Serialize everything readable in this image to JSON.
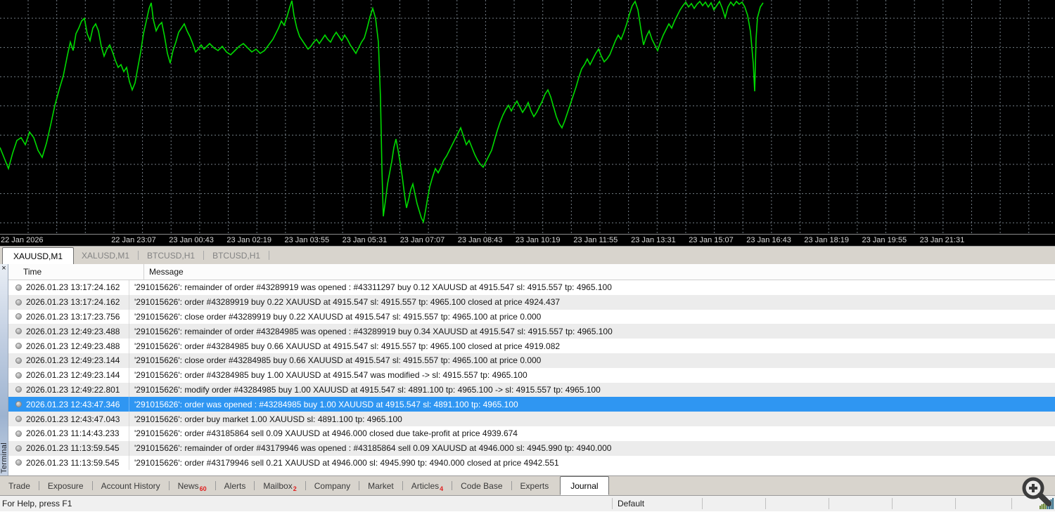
{
  "chart": {
    "background": "#000000",
    "grid_color": "#737d85",
    "line_color": "#00da00",
    "axis_line_color": "#9a9a9a",
    "axis_labels": [
      "22 Jan 2026",
      "22 Jan 23:07",
      "23 Jan 00:43",
      "23 Jan 02:19",
      "23 Jan 03:55",
      "23 Jan 05:31",
      "23 Jan 07:07",
      "23 Jan 08:43",
      "23 Jan 10:19",
      "23 Jan 11:55",
      "23 Jan 13:31",
      "23 Jan 15:07",
      "23 Jan 16:43",
      "23 Jan 18:19",
      "23 Jan 19:55",
      "23 Jan 21:31"
    ],
    "line_points": [
      [
        0,
        210
      ],
      [
        6,
        225
      ],
      [
        12,
        240
      ],
      [
        18,
        218
      ],
      [
        24,
        200
      ],
      [
        30,
        196
      ],
      [
        36,
        206
      ],
      [
        42,
        188
      ],
      [
        48,
        196
      ],
      [
        54,
        214
      ],
      [
        60,
        224
      ],
      [
        66,
        204
      ],
      [
        72,
        178
      ],
      [
        78,
        150
      ],
      [
        84,
        128
      ],
      [
        90,
        108
      ],
      [
        96,
        78
      ],
      [
        100,
        60
      ],
      [
        104,
        72
      ],
      [
        108,
        48
      ],
      [
        112,
        40
      ],
      [
        116,
        30
      ],
      [
        120,
        26
      ],
      [
        124,
        48
      ],
      [
        128,
        58
      ],
      [
        132,
        40
      ],
      [
        136,
        34
      ],
      [
        140,
        44
      ],
      [
        144,
        66
      ],
      [
        148,
        80
      ],
      [
        152,
        70
      ],
      [
        156,
        64
      ],
      [
        160,
        74
      ],
      [
        164,
        86
      ],
      [
        168,
        96
      ],
      [
        172,
        92
      ],
      [
        176,
        102
      ],
      [
        180,
        96
      ],
      [
        184,
        116
      ],
      [
        188,
        128
      ],
      [
        192,
        118
      ],
      [
        196,
        96
      ],
      [
        200,
        74
      ],
      [
        204,
        48
      ],
      [
        208,
        30
      ],
      [
        212,
        12
      ],
      [
        215,
        4
      ],
      [
        218,
        28
      ],
      [
        222,
        44
      ],
      [
        226,
        36
      ],
      [
        230,
        32
      ],
      [
        234,
        52
      ],
      [
        238,
        76
      ],
      [
        242,
        90
      ],
      [
        246,
        72
      ],
      [
        250,
        60
      ],
      [
        254,
        46
      ],
      [
        258,
        40
      ],
      [
        262,
        34
      ],
      [
        266,
        44
      ],
      [
        270,
        52
      ],
      [
        274,
        62
      ],
      [
        278,
        74
      ],
      [
        282,
        70
      ],
      [
        286,
        64
      ],
      [
        290,
        70
      ],
      [
        294,
        66
      ],
      [
        298,
        62
      ],
      [
        304,
        68
      ],
      [
        310,
        72
      ],
      [
        316,
        66
      ],
      [
        322,
        74
      ],
      [
        328,
        78
      ],
      [
        334,
        72
      ],
      [
        340,
        66
      ],
      [
        346,
        62
      ],
      [
        352,
        68
      ],
      [
        358,
        74
      ],
      [
        364,
        70
      ],
      [
        370,
        76
      ],
      [
        376,
        72
      ],
      [
        382,
        64
      ],
      [
        388,
        56
      ],
      [
        392,
        48
      ],
      [
        396,
        40
      ],
      [
        400,
        30
      ],
      [
        404,
        36
      ],
      [
        408,
        24
      ],
      [
        412,
        10
      ],
      [
        415,
        1
      ],
      [
        418,
        22
      ],
      [
        422,
        40
      ],
      [
        426,
        52
      ],
      [
        430,
        58
      ],
      [
        434,
        64
      ],
      [
        438,
        70
      ],
      [
        442,
        66
      ],
      [
        446,
        60
      ],
      [
        450,
        56
      ],
      [
        454,
        62
      ],
      [
        458,
        56
      ],
      [
        462,
        50
      ],
      [
        466,
        56
      ],
      [
        470,
        60
      ],
      [
        474,
        52
      ],
      [
        478,
        46
      ],
      [
        482,
        52
      ],
      [
        486,
        58
      ],
      [
        490,
        50
      ],
      [
        494,
        56
      ],
      [
        498,
        64
      ],
      [
        502,
        70
      ],
      [
        506,
        76
      ],
      [
        510,
        68
      ],
      [
        514,
        60
      ],
      [
        518,
        54
      ],
      [
        522,
        40
      ],
      [
        526,
        24
      ],
      [
        530,
        12
      ],
      [
        534,
        26
      ],
      [
        538,
        60
      ],
      [
        541,
        140
      ],
      [
        543,
        240
      ],
      [
        545,
        308
      ],
      [
        548,
        286
      ],
      [
        551,
        262
      ],
      [
        554,
        246
      ],
      [
        557,
        230
      ],
      [
        560,
        210
      ],
      [
        563,
        198
      ],
      [
        566,
        214
      ],
      [
        569,
        232
      ],
      [
        572,
        252
      ],
      [
        575,
        276
      ],
      [
        578,
        296
      ],
      [
        581,
        284
      ],
      [
        584,
        270
      ],
      [
        587,
        262
      ],
      [
        590,
        276
      ],
      [
        593,
        290
      ],
      [
        596,
        300
      ],
      [
        599,
        310
      ],
      [
        602,
        316
      ],
      [
        605,
        300
      ],
      [
        608,
        282
      ],
      [
        611,
        266
      ],
      [
        615,
        252
      ],
      [
        619,
        240
      ],
      [
        623,
        246
      ],
      [
        627,
        238
      ],
      [
        631,
        228
      ],
      [
        635,
        222
      ],
      [
        639,
        214
      ],
      [
        643,
        206
      ],
      [
        647,
        198
      ],
      [
        651,
        190
      ],
      [
        655,
        182
      ],
      [
        659,
        194
      ],
      [
        663,
        206
      ],
      [
        667,
        200
      ],
      [
        671,
        210
      ],
      [
        675,
        220
      ],
      [
        679,
        228
      ],
      [
        683,
        234
      ],
      [
        687,
        238
      ],
      [
        691,
        230
      ],
      [
        695,
        222
      ],
      [
        699,
        214
      ],
      [
        703,
        200
      ],
      [
        707,
        186
      ],
      [
        711,
        174
      ],
      [
        715,
        164
      ],
      [
        719,
        156
      ],
      [
        723,
        150
      ],
      [
        727,
        158
      ],
      [
        731,
        150
      ],
      [
        735,
        144
      ],
      [
        739,
        152
      ],
      [
        743,
        160
      ],
      [
        747,
        154
      ],
      [
        751,
        146
      ],
      [
        755,
        158
      ],
      [
        759,
        166
      ],
      [
        763,
        160
      ],
      [
        767,
        152
      ],
      [
        771,
        144
      ],
      [
        775,
        134
      ],
      [
        779,
        128
      ],
      [
        783,
        138
      ],
      [
        787,
        152
      ],
      [
        791,
        166
      ],
      [
        795,
        176
      ],
      [
        799,
        182
      ],
      [
        803,
        172
      ],
      [
        807,
        160
      ],
      [
        811,
        148
      ],
      [
        815,
        136
      ],
      [
        819,
        124
      ],
      [
        823,
        110
      ],
      [
        827,
        98
      ],
      [
        831,
        92
      ],
      [
        835,
        84
      ],
      [
        839,
        92
      ],
      [
        843,
        84
      ],
      [
        847,
        76
      ],
      [
        851,
        70
      ],
      [
        855,
        80
      ],
      [
        859,
        88
      ],
      [
        863,
        84
      ],
      [
        867,
        78
      ],
      [
        871,
        68
      ],
      [
        875,
        58
      ],
      [
        879,
        50
      ],
      [
        883,
        56
      ],
      [
        887,
        46
      ],
      [
        891,
        34
      ],
      [
        895,
        20
      ],
      [
        899,
        8
      ],
      [
        903,
        2
      ],
      [
        907,
        14
      ],
      [
        911,
        40
      ],
      [
        915,
        64
      ],
      [
        919,
        52
      ],
      [
        923,
        44
      ],
      [
        927,
        56
      ],
      [
        931,
        64
      ],
      [
        935,
        72
      ],
      [
        939,
        60
      ],
      [
        943,
        50
      ],
      [
        947,
        42
      ],
      [
        951,
        34
      ],
      [
        955,
        40
      ],
      [
        959,
        30
      ],
      [
        963,
        22
      ],
      [
        967,
        14
      ],
      [
        971,
        8
      ],
      [
        975,
        3
      ],
      [
        979,
        10
      ],
      [
        983,
        5
      ],
      [
        987,
        12
      ],
      [
        991,
        6
      ],
      [
        995,
        2
      ],
      [
        999,
        8
      ],
      [
        1003,
        3
      ],
      [
        1007,
        10
      ],
      [
        1011,
        4
      ],
      [
        1015,
        14
      ],
      [
        1019,
        8
      ],
      [
        1023,
        2
      ],
      [
        1027,
        12
      ],
      [
        1031,
        25
      ],
      [
        1035,
        10
      ],
      [
        1039,
        3
      ],
      [
        1043,
        8
      ],
      [
        1047,
        2
      ],
      [
        1051,
        6
      ],
      [
        1055,
        3
      ],
      [
        1059,
        10
      ],
      [
        1063,
        22
      ],
      [
        1067,
        45
      ],
      [
        1071,
        90
      ],
      [
        1073,
        130
      ],
      [
        1075,
        55
      ],
      [
        1077,
        25
      ],
      [
        1081,
        10
      ],
      [
        1085,
        4
      ]
    ]
  },
  "chart_tabs": [
    {
      "label": "XAUUSD,M1",
      "active": true
    },
    {
      "label": "XALUSD,M1",
      "active": false
    },
    {
      "label": "BTCUSD,H1",
      "active": false
    },
    {
      "label": "BTCUSD,H1",
      "active": false
    }
  ],
  "terminal": {
    "close_label": "×",
    "panel_label": "Terminal",
    "columns": [
      "Time",
      "Message"
    ],
    "selected_row_color": "#2f96f2",
    "rows": [
      {
        "time": "2026.01.23 13:17:24.162",
        "message": "'291015626': remainder of order #43289919 was opened : #43311297 buy 0.12 XAUUSD at 4915.547 sl: 4915.557 tp: 4965.100",
        "selected": false
      },
      {
        "time": "2026.01.23 13:17:24.162",
        "message": "'291015626': order #43289919 buy 0.22 XAUUSD at 4915.547 sl: 4915.557 tp: 4965.100 closed at price 4924.437",
        "selected": false
      },
      {
        "time": "2026.01.23 13:17:23.756",
        "message": "'291015626': close order #43289919 buy 0.22 XAUUSD at 4915.547 sl: 4915.557 tp: 4965.100 at price 0.000",
        "selected": false
      },
      {
        "time": "2026.01.23 12:49:23.488",
        "message": "'291015626': remainder of order #43284985 was opened : #43289919 buy 0.34 XAUUSD at 4915.547 sl: 4915.557 tp: 4965.100",
        "selected": false
      },
      {
        "time": "2026.01.23 12:49:23.488",
        "message": "'291015626': order #43284985 buy 0.66 XAUUSD at 4915.547 sl: 4915.557 tp: 4965.100 closed at price 4919.082",
        "selected": false
      },
      {
        "time": "2026.01.23 12:49:23.144",
        "message": "'291015626': close order #43284985 buy 0.66 XAUUSD at 4915.547 sl: 4915.557 tp: 4965.100 at price 0.000",
        "selected": false
      },
      {
        "time": "2026.01.23 12:49:23.144",
        "message": "'291015626': order #43284985 buy 1.00 XAUUSD at 4915.547 was modified -> sl: 4915.557 tp: 4965.100",
        "selected": false
      },
      {
        "time": "2026.01.23 12:49:22.801",
        "message": "'291015626': modify order #43284985 buy 1.00 XAUUSD at 4915.547 sl: 4891.100 tp: 4965.100 -> sl: 4915.557 tp: 4965.100",
        "selected": false
      },
      {
        "time": "2026.01.23 12:43:47.346",
        "message": "'291015626': order was opened : #43284985 buy 1.00 XAUUSD at 4915.547 sl: 4891.100 tp: 4965.100",
        "selected": true
      },
      {
        "time": "2026.01.23 12:43:47.043",
        "message": "'291015626': order buy market 1.00 XAUUSD sl: 4891.100 tp: 4965.100",
        "selected": false
      },
      {
        "time": "2026.01.23 11:14:43.233",
        "message": "'291015626': order #43185864 sell 0.09 XAUUSD at 4946.000 closed due take-profit at price 4939.674",
        "selected": false
      },
      {
        "time": "2026.01.23 11:13:59.545",
        "message": "'291015626': remainder of order #43179946 was opened : #43185864 sell 0.09 XAUUSD at 4946.000 sl: 4945.990 tp: 4940.000",
        "selected": false
      },
      {
        "time": "2026.01.23 11:13:59.545",
        "message": "'291015626': order #43179946 sell 0.21 XAUUSD at 4946.000 sl: 4945.990 tp: 4940.000 closed at price 4942.551",
        "selected": false
      }
    ]
  },
  "bottom_tabs": [
    {
      "label": "Trade",
      "badge": "",
      "active": false
    },
    {
      "label": "Exposure",
      "badge": "",
      "active": false
    },
    {
      "label": "Account History",
      "badge": "",
      "active": false
    },
    {
      "label": "News",
      "badge": "60",
      "active": false
    },
    {
      "label": "Alerts",
      "badge": "",
      "active": false
    },
    {
      "label": "Mailbox",
      "badge": "2",
      "active": false
    },
    {
      "label": "Company",
      "badge": "",
      "active": false
    },
    {
      "label": "Market",
      "badge": "",
      "active": false
    },
    {
      "label": "Articles",
      "badge": "4",
      "active": false
    },
    {
      "label": "Code Base",
      "badge": "",
      "active": false
    },
    {
      "label": "Experts",
      "badge": "",
      "active": false
    },
    {
      "label": "Journal",
      "badge": "",
      "active": true
    }
  ],
  "status_bar": {
    "help_text": "For Help, press F1",
    "profile": "Default",
    "badge_color": "#e01f1f",
    "connection_bar_colors": [
      "#5b7a1e",
      "#20607e"
    ]
  }
}
